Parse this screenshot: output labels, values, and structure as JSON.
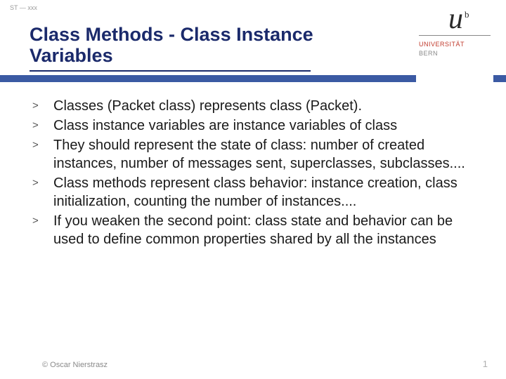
{
  "header": {
    "tinyLabel": "ST — xxx",
    "title": "Class Methods - Class Instance Variables"
  },
  "logo": {
    "u": "u",
    "b": "b",
    "line1": "UNIVERSITÄT",
    "line2": "BERN"
  },
  "bullets": [
    "Classes (Packet class) represents class (Packet).",
    "Class instance variables are instance variables of class",
    "They should represent the state of class: number of created instances, number of messages sent, superclasses, subclasses....",
    "Class methods represent class behavior: instance creation, class initialization, counting the number of instances....",
    "If you weaken the second point: class state and behavior can be used to define common properties shared by all the instances"
  ],
  "footer": {
    "copyright": "© Oscar Nierstrasz",
    "page": "1"
  }
}
